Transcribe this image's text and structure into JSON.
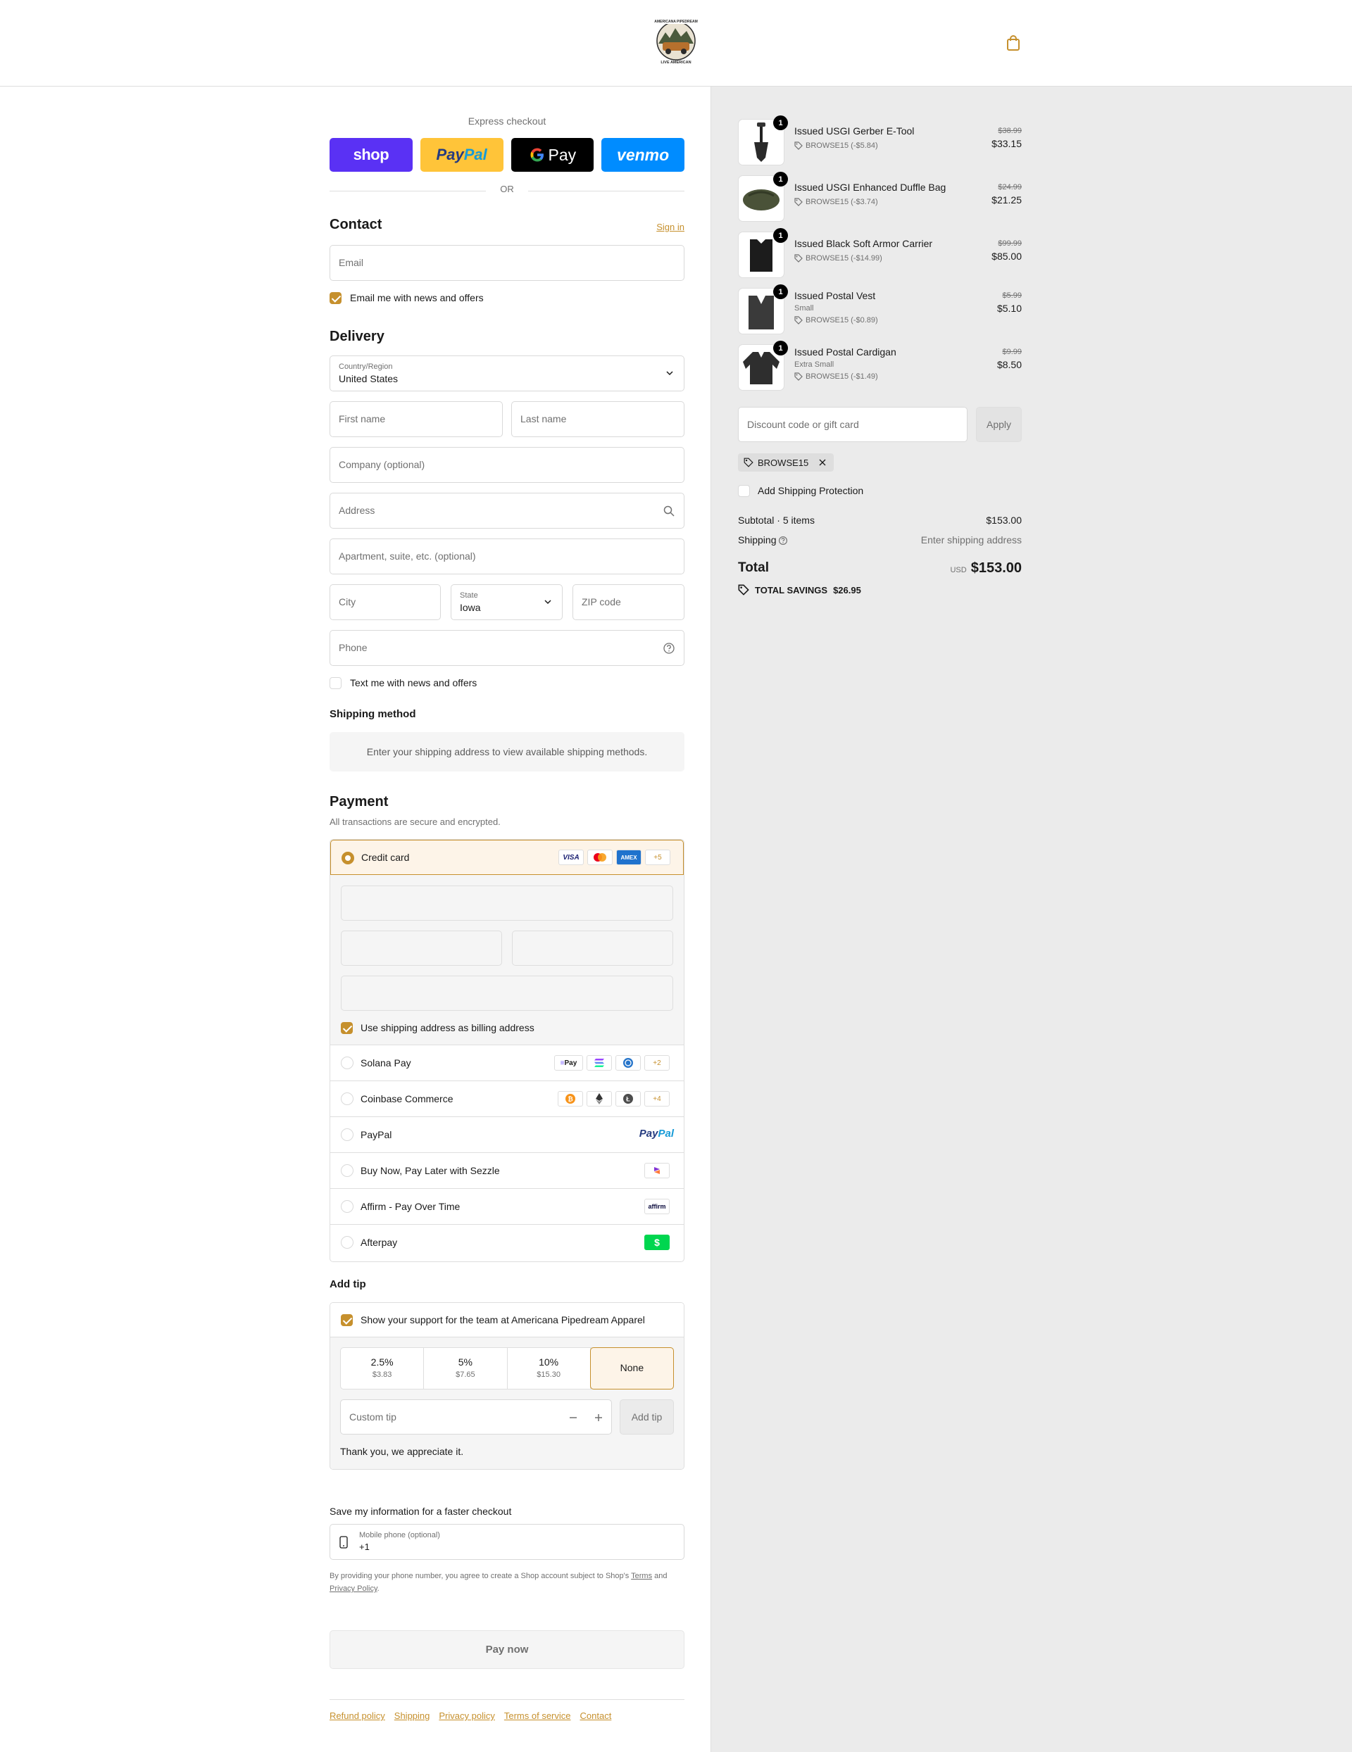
{
  "header": {
    "logo_text": "AMERICANA PIPEDREAM",
    "logo_sub": "LIVE AMERICAN"
  },
  "express": {
    "title": "Express checkout",
    "shop": "shop",
    "paypal_a": "Pay",
    "paypal_b": "Pal",
    "gpay": "Pay",
    "venmo": "venmo",
    "or": "OR"
  },
  "contact": {
    "title": "Contact",
    "sign_in": "Sign in",
    "email_placeholder": "Email",
    "news_label": "Email me with news and offers"
  },
  "delivery": {
    "title": "Delivery",
    "country_label": "Country/Region",
    "country_value": "United States",
    "first_name": "First name",
    "last_name": "Last name",
    "company": "Company (optional)",
    "address": "Address",
    "apartment": "Apartment, suite, etc. (optional)",
    "city": "City",
    "state_label": "State",
    "state_value": "Iowa",
    "zip": "ZIP code",
    "phone": "Phone",
    "text_label": "Text me with news and offers"
  },
  "shipping": {
    "title": "Shipping method",
    "message": "Enter your shipping address to view available shipping methods."
  },
  "payment": {
    "title": "Payment",
    "subtitle": "All transactions are secure and encrypted.",
    "credit_card": "Credit card",
    "cc_more": "+5",
    "billing_label": "Use shipping address as billing address",
    "methods": [
      {
        "label": "Solana Pay",
        "more": "+2"
      },
      {
        "label": "Coinbase Commerce",
        "more": "+4"
      },
      {
        "label": "PayPal"
      },
      {
        "label": "Buy Now, Pay Later with Sezzle"
      },
      {
        "label": "Affirm - Pay Over Time"
      },
      {
        "label": "Afterpay"
      }
    ],
    "solana_badge": "Pay",
    "paypal_badge_a": "Pay",
    "paypal_badge_b": "Pal",
    "affirm_badge": "affirm",
    "visa": "VISA",
    "amex": "AMEX"
  },
  "tip": {
    "title": "Add tip",
    "support_label": "Show your support for the team at Americana Pipedream Apparel",
    "options": [
      {
        "pct": "2.5%",
        "amt": "$3.83"
      },
      {
        "pct": "5%",
        "amt": "$7.65"
      },
      {
        "pct": "10%",
        "amt": "$15.30"
      },
      {
        "pct": "None"
      }
    ],
    "custom_placeholder": "Custom tip",
    "add_label": "Add tip",
    "thanks": "Thank you, we appreciate it."
  },
  "save": {
    "title": "Save my information for a faster checkout",
    "phone_label": "Mobile phone (optional)",
    "phone_value": "+1",
    "legal_a": "By providing your phone number, you agree to create a Shop account subject to Shop's",
    "terms": "Terms",
    "and": "and",
    "privacy": "Privacy Policy",
    "period": "."
  },
  "pay_now": "Pay now",
  "footer": {
    "links": [
      "Refund policy",
      "Shipping",
      "Privacy policy",
      "Terms of service",
      "Contact"
    ]
  },
  "cart": {
    "items": [
      {
        "name": "Issued USGI Gerber E-Tool",
        "variant": "",
        "discount": "BROWSE15 (-$5.84)",
        "old": "$38.99",
        "new": "$33.15",
        "qty": "1"
      },
      {
        "name": "Issued USGI Enhanced Duffle Bag",
        "variant": "",
        "discount": "BROWSE15 (-$3.74)",
        "old": "$24.99",
        "new": "$21.25",
        "qty": "1"
      },
      {
        "name": "Issued Black Soft Armor Carrier",
        "variant": "",
        "discount": "BROWSE15 (-$14.99)",
        "old": "$99.99",
        "new": "$85.00",
        "qty": "1"
      },
      {
        "name": "Issued Postal Vest",
        "variant": "Small",
        "discount": "BROWSE15 (-$0.89)",
        "old": "$5.99",
        "new": "$5.10",
        "qty": "1"
      },
      {
        "name": "Issued Postal Cardigan",
        "variant": "Extra Small",
        "discount": "BROWSE15 (-$1.49)",
        "old": "$9.99",
        "new": "$8.50",
        "qty": "1"
      }
    ],
    "discount_placeholder": "Discount code or gift card",
    "apply": "Apply",
    "code": "BROWSE15",
    "protection": "Add Shipping Protection",
    "subtotal_label": "Subtotal · 5 items",
    "subtotal_value": "$153.00",
    "shipping_label": "Shipping",
    "shipping_value": "Enter shipping address",
    "total_label": "Total",
    "currency": "USD",
    "total_value": "$153.00",
    "savings_label": "TOTAL SAVINGS",
    "savings_value": "$26.95"
  },
  "colors": {
    "accent": "#c6902d",
    "sidebar_bg": "#ebebeb",
    "shop": "#5a31f4",
    "paypal": "#ffc439",
    "venmo": "#008cff"
  }
}
